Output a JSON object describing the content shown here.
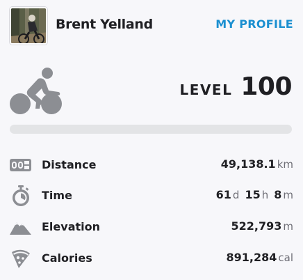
{
  "header": {
    "user_name": "Brent Yelland",
    "profile_link": "MY PROFILE"
  },
  "level": {
    "label": "LEVEL",
    "value": "100",
    "progress_fraction": 0.0
  },
  "stats": {
    "distance": {
      "label": "Distance",
      "value": "49,138.1",
      "unit": "km"
    },
    "time": {
      "label": "Time",
      "days": "61",
      "days_unit": "d",
      "hours": "15",
      "hours_unit": "h",
      "minutes": "8",
      "minutes_unit": "m"
    },
    "elevation": {
      "label": "Elevation",
      "value": "522,793",
      "unit": "m"
    },
    "calories": {
      "label": "Calories",
      "value": "891,284",
      "unit": "cal"
    }
  },
  "colors": {
    "accent": "#1a8fd0",
    "icon_gray": "#8c8e93",
    "progress_track": "#e3e4e6",
    "background": "#f7f7fa"
  },
  "icons": [
    "bike-icon",
    "odometer-icon",
    "stopwatch-icon",
    "mountain-icon",
    "pizza-icon"
  ]
}
